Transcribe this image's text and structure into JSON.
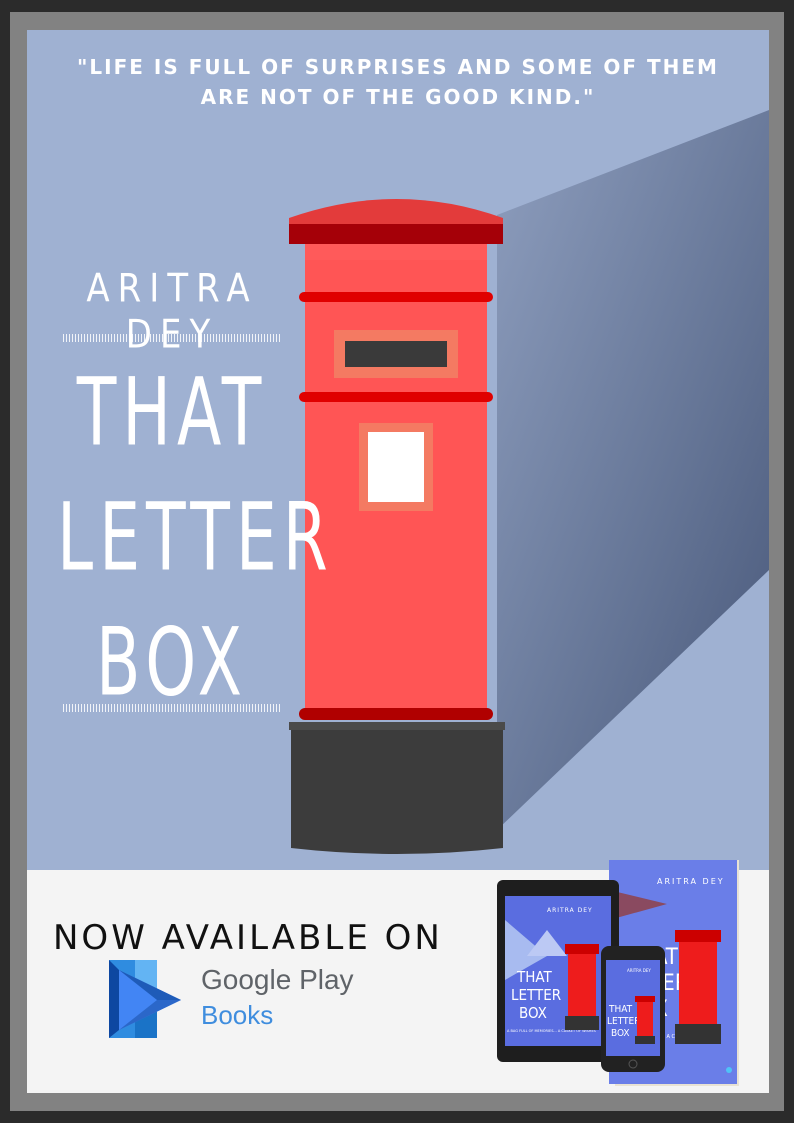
{
  "quote": {
    "line1": "\"LIFE IS FULL OF SURPRISES AND SOME OF THEM",
    "line2": "ARE NOT OF THE GOOD KIND.\""
  },
  "author": "ARITRA DEY",
  "title": {
    "line1": "THAT",
    "line2": "LETTER",
    "line3": "BOX"
  },
  "cta": {
    "now_available": "NOW AVAILABLE ON",
    "store_line1": "Google Play",
    "store_line2": "Books"
  },
  "mockup": {
    "author": "ARITRA DEY",
    "title1": "THAT",
    "title2": "LETTER",
    "title3": "BOX",
    "tagline": "A BAG FULL OF MEMORIES... A CASKET OF WISHES",
    "tagline_book": "FULL OF MEMORIES... A CASKET OF WISHES"
  },
  "colors": {
    "background": "#9fb1d2",
    "mailbox_red": "#ff5555",
    "mailbox_dark_red": "#a50008",
    "base": "#3c3c3c",
    "band": "#f4f4f4",
    "gp_blue": "#3f8dde"
  }
}
